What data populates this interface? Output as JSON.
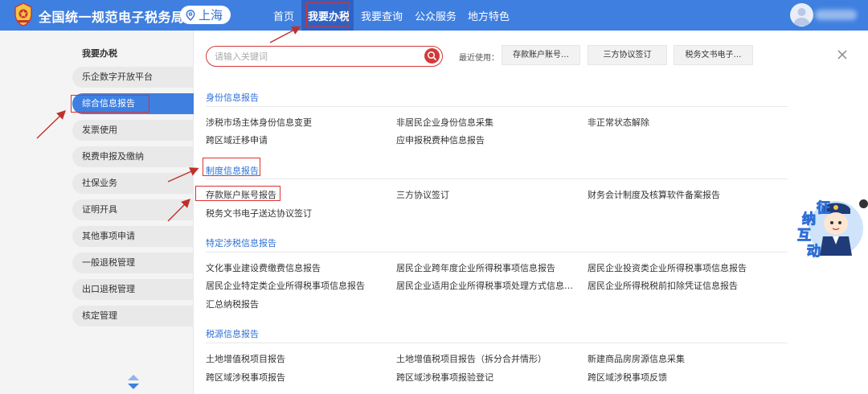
{
  "header": {
    "site_title": "全国统一规范电子税务局",
    "city": "上海",
    "nav": [
      {
        "label": "首页",
        "active": false
      },
      {
        "label": "我要办税",
        "active": true
      },
      {
        "label": "我要查询",
        "active": false
      },
      {
        "label": "公众服务",
        "active": false
      },
      {
        "label": "地方特色",
        "active": false
      }
    ],
    "colors": {
      "bar": "#3f7fe0",
      "active": "#2d62c2",
      "highlight": "#e03030"
    }
  },
  "sidebar": {
    "title": "我要办税",
    "items": [
      {
        "label": "乐企数字开放平台",
        "active": false
      },
      {
        "label": "综合信息报告",
        "active": true
      },
      {
        "label": "发票使用",
        "active": false
      },
      {
        "label": "税费申报及缴纳",
        "active": false
      },
      {
        "label": "社保业务",
        "active": false
      },
      {
        "label": "证明开具",
        "active": false
      },
      {
        "label": "其他事项申请",
        "active": false
      },
      {
        "label": "一般退税管理",
        "active": false
      },
      {
        "label": "出口退税管理",
        "active": false
      },
      {
        "label": "核定管理",
        "active": false
      }
    ]
  },
  "search": {
    "placeholder": "请输入关键词",
    "value": ""
  },
  "recent": {
    "label": "最近使用：",
    "items": [
      "存款账户账号…",
      "三方协议签订",
      "税务文书电子…"
    ]
  },
  "sections": [
    {
      "title": "身份信息报告",
      "items": [
        "涉税市场主体身份信息变更",
        "非居民企业身份信息采集",
        "非正常状态解除",
        "跨区域迁移申请",
        "应申报税费种信息报告"
      ]
    },
    {
      "title": "制度信息报告",
      "items": [
        "存款账户账号报告",
        "三方协议签订",
        "财务会计制度及核算软件备案报告",
        "税务文书电子送达协议签订"
      ]
    },
    {
      "title": "特定涉税信息报告",
      "items": [
        "文化事业建设费缴费信息报告",
        "居民企业跨年度企业所得税事项信息报告",
        "居民企业投资类企业所得税事项信息报告",
        "居民企业特定类企业所得税事项信息报告",
        "居民企业适用企业所得税事项处理方式信息…",
        "居民企业所得税税前扣除凭证信息报告",
        "汇总纳税报告"
      ]
    },
    {
      "title": "税源信息报告",
      "items": [
        "土地增值税项目报告",
        "土地增值税项目报告（拆分合并情形）",
        "新建商品房房源信息采集",
        "跨区域涉税事项报告",
        "跨区域涉税事项报验登记",
        "跨区域涉税事项反馈"
      ]
    }
  ],
  "mascot": {
    "chars": [
      "征",
      "纳",
      "互",
      "动"
    ]
  }
}
